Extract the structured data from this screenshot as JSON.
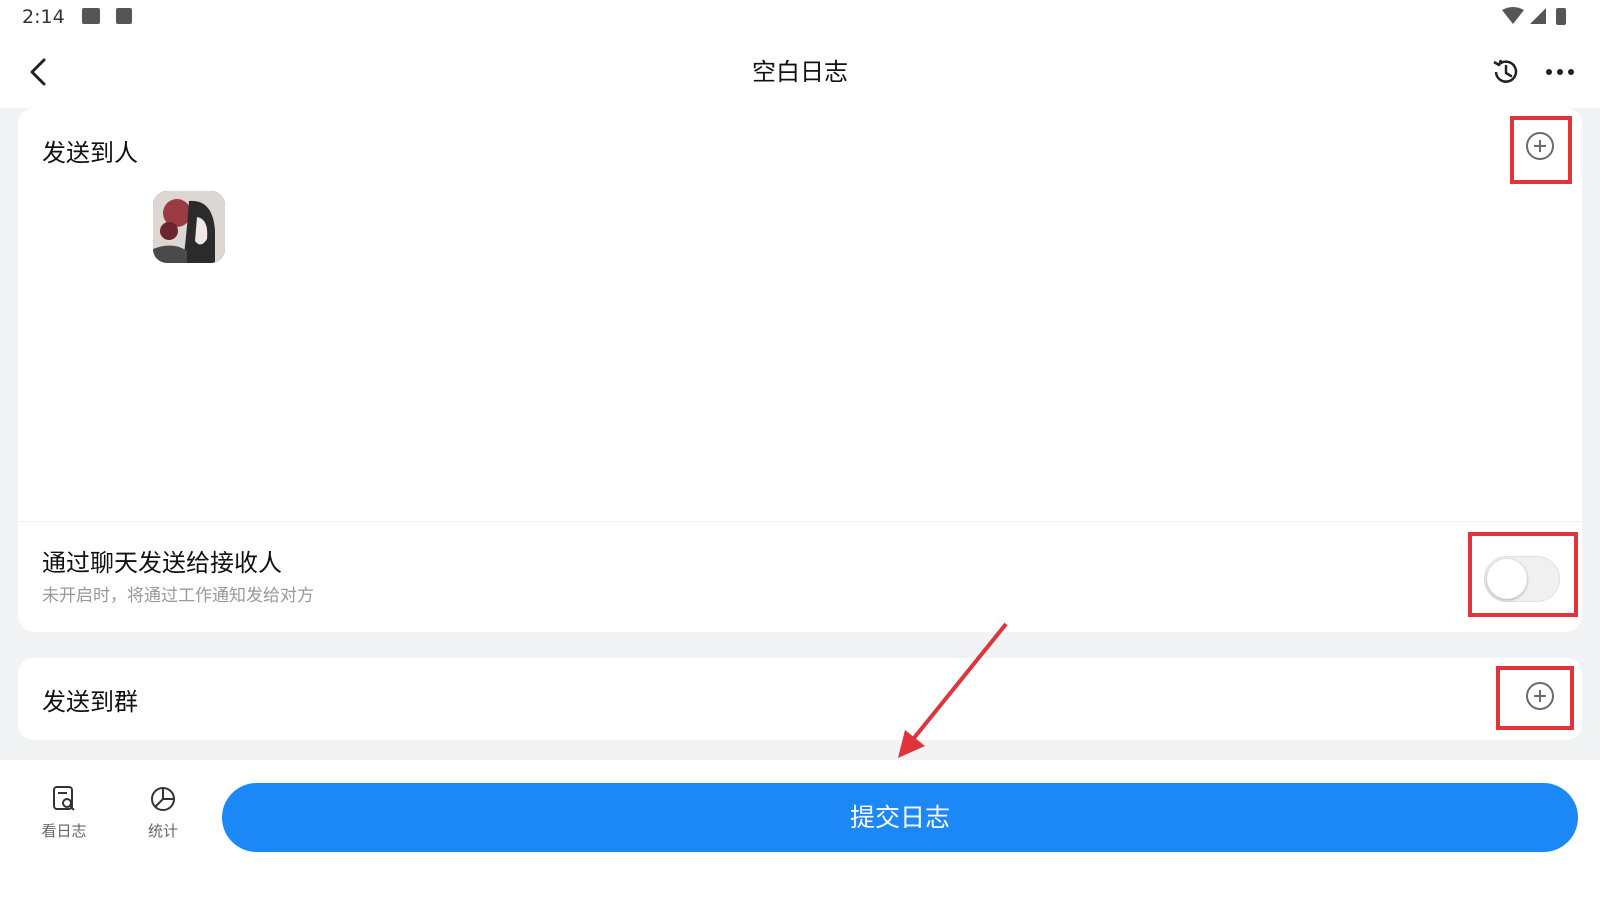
{
  "status_bar": {
    "time": "2:14"
  },
  "app_bar": {
    "title": "空白日志"
  },
  "recipients": {
    "label": "发送到人",
    "chat_send": {
      "title": "通过聊天发送给接收人",
      "subtitle": "未开启时，将通过工作通知发给对方",
      "enabled": false
    }
  },
  "groups": {
    "label": "发送到群"
  },
  "bottom_bar": {
    "tabs": [
      {
        "label": "看日志",
        "icon": "view-log-icon"
      },
      {
        "label": "统计",
        "icon": "stats-icon"
      }
    ],
    "submit_label": "提交日志"
  },
  "colors": {
    "accent": "#1c87f7",
    "annotation": "#e0333a"
  }
}
